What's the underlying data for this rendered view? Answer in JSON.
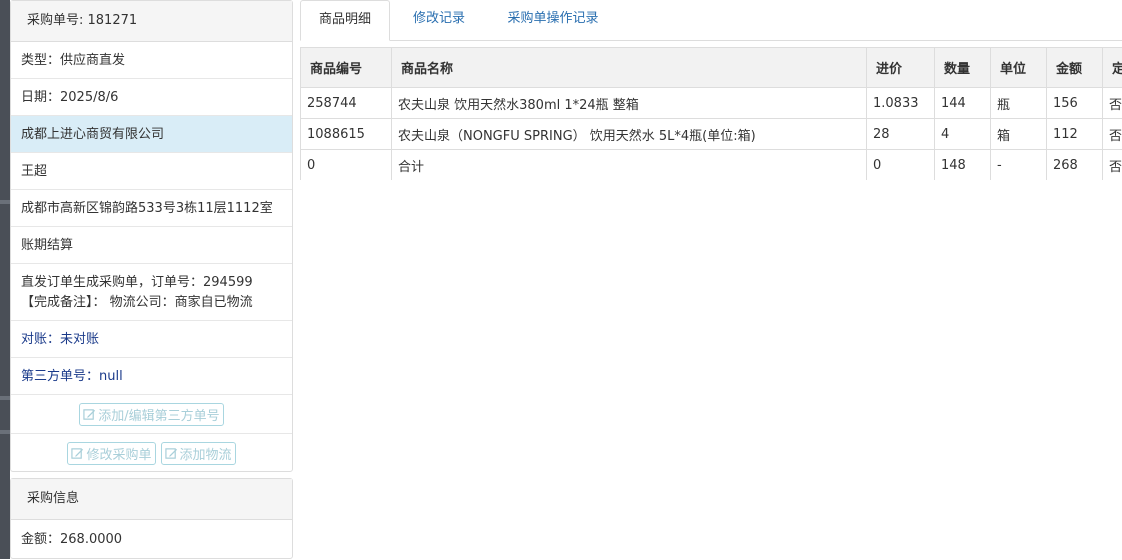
{
  "order": {
    "header": "采购单号: 181271",
    "type": "类型：供应商直发",
    "date": "日期：2025/8/6",
    "supplier": "成都上进心商贸有限公司",
    "contact": "王超",
    "address": "成都市高新区锦韵路533号3栋11层1112室",
    "payment": "账期结算",
    "note_line1": "直发订单生成采购单，订单号：294599",
    "note_line2": "【完成备注】： 物流公司：商家自已物流",
    "reconcile": "对账：未对账",
    "third_party": "第三方单号：null",
    "btn_add_third": "添加/编辑第三方单号",
    "btn_edit_order": "修改采购单",
    "btn_add_logistics": "添加物流"
  },
  "purchase_info": {
    "header": "采购信息",
    "amount": "金额：268.0000"
  },
  "tabs": [
    {
      "label": "商品明细"
    },
    {
      "label": "修改记录"
    },
    {
      "label": "采购单操作记录"
    }
  ],
  "table": {
    "headers": [
      "商品编号",
      "商品名称",
      "进价",
      "数量",
      "单位",
      "金额",
      "定"
    ],
    "rows": [
      [
        "258744",
        "农夫山泉 饮用天然水380ml 1*24瓶 整箱",
        "1.0833",
        "144",
        "瓶",
        "156",
        "否"
      ],
      [
        "1088615",
        "农夫山泉（NONGFU SPRING） 饮用天然水 5L*4瓶(单位:箱)",
        "28",
        "4",
        "箱",
        "112",
        "否"
      ],
      [
        "0",
        "合计",
        "0",
        "148",
        "-",
        "268",
        "否"
      ]
    ]
  }
}
